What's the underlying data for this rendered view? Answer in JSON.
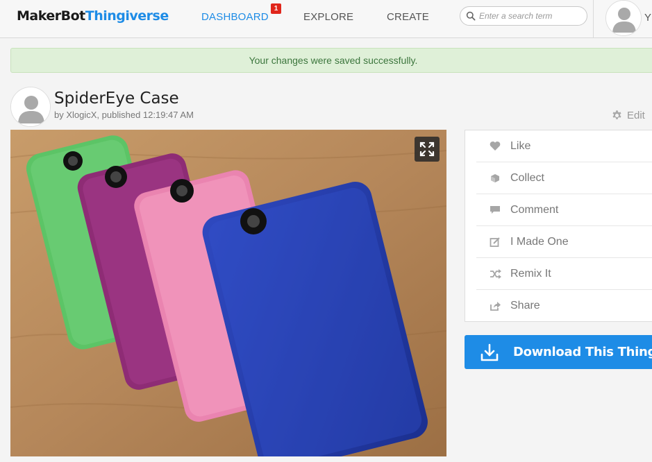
{
  "nav": {
    "logo_part1": "MakerBot",
    "logo_part2": "Thingiverse",
    "links": [
      {
        "label": "DASHBOARD"
      },
      {
        "label": "EXPLORE"
      },
      {
        "label": "CREATE"
      }
    ],
    "dashboard_badge": "1",
    "search_placeholder": "Enter a search term",
    "user_initial": "Y",
    "accent_color": "#1e8ce6"
  },
  "flash": {
    "message": "Your changes were saved successfully."
  },
  "thing": {
    "title": "SpiderEye Case",
    "byline": "by XlogicX, published 12:19:47 AM",
    "edit_label": "Edit"
  },
  "actions": [
    {
      "label": "Like",
      "icon": "heart-icon"
    },
    {
      "label": "Collect",
      "icon": "collect-icon"
    },
    {
      "label": "Comment",
      "icon": "comment-icon"
    },
    {
      "label": "I Made One",
      "icon": "made-one-icon"
    },
    {
      "label": "Remix It",
      "icon": "remix-icon"
    },
    {
      "label": "Share",
      "icon": "share-icon"
    }
  ],
  "download": {
    "label": "Download This Thing!"
  }
}
